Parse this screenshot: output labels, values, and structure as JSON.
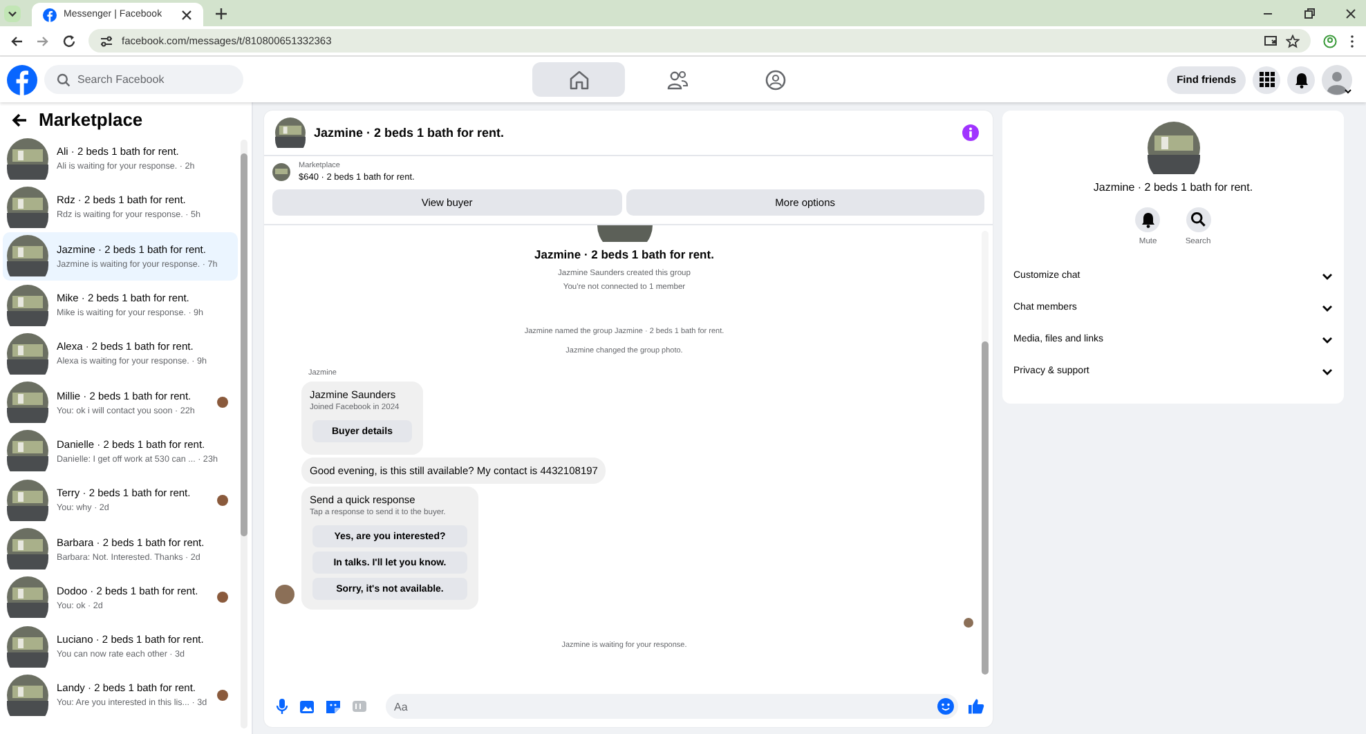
{
  "browser": {
    "tab_title": "Messenger | Facebook",
    "url": "facebook.com/messages/t/810800651332363"
  },
  "header": {
    "search": {
      "placeholder": "Search Facebook"
    },
    "nav": [
      {
        "kind": "home",
        "selected": true
      },
      {
        "kind": "friends",
        "selected": false
      },
      {
        "kind": "groups",
        "selected": false
      }
    ],
    "find_friends": "Find friends"
  },
  "sidebar": {
    "title": "Marketplace",
    "items": [
      {
        "title": "Ali · 2 beds 1 bath for rent.",
        "preview": "Ali is waiting for your response. · 2h",
        "selected": false,
        "seen": false
      },
      {
        "title": "Rdz · 2 beds 1 bath for rent.",
        "preview": "Rdz is waiting for your response. · 5h",
        "selected": false,
        "seen": false
      },
      {
        "title": "Jazmine · 2 beds 1 bath for rent.",
        "preview": "Jazmine is waiting for your response. · 7h",
        "selected": true,
        "seen": false
      },
      {
        "title": "Mike · 2 beds 1 bath for rent.",
        "preview": "Mike is waiting for your response. · 9h",
        "selected": false,
        "seen": false
      },
      {
        "title": "Alexa · 2 beds 1 bath for rent.",
        "preview": "Alexa is waiting for your response. · 9h",
        "selected": false,
        "seen": false
      },
      {
        "title": "Millie · 2 beds 1 bath for rent.",
        "preview": "You: ok i will contact you soon · 22h",
        "selected": false,
        "seen": true
      },
      {
        "title": "Danielle · 2 beds 1 bath for rent.",
        "preview": "Danielle: I get off work at 530 can ... · 23h",
        "selected": false,
        "seen": false
      },
      {
        "title": "Terry · 2 beds 1 bath for rent.",
        "preview": "You: why · 2d",
        "selected": false,
        "seen": true
      },
      {
        "title": "Barbara · 2 beds 1 bath for rent.",
        "preview": "Barbara: Not. Interested. Thanks · 2d",
        "selected": false,
        "seen": false
      },
      {
        "title": "Dodoo · 2 beds 1 bath for rent.",
        "preview": "You: ok · 2d",
        "selected": false,
        "seen": true
      },
      {
        "title": "Luciano · 2 beds 1 bath for rent.",
        "preview": "You can now rate each other · 3d",
        "selected": false,
        "seen": false
      },
      {
        "title": "Landy · 2 beds 1 bath for rent.",
        "preview": "You: Are you interested in this lis... · 3d",
        "selected": false,
        "seen": true
      }
    ]
  },
  "chat": {
    "title": "Jazmine · 2 beds 1 bath for rent.",
    "listing": {
      "label": "Marketplace",
      "item": "$640 · 2 beds 1 bath for rent."
    },
    "actions": [
      "View buyer",
      "More options"
    ],
    "intro": {
      "title": "Jazmine · 2 beds 1 bath for rent.",
      "lines": [
        "Jazmine Saunders created this group",
        "You're not connected to 1 member"
      ]
    },
    "events": [
      "Jazmine named the group Jazmine · 2 beds 1 bath for rent.",
      "Jazmine changed the group photo."
    ],
    "sender": "Jazmine",
    "messages": [
      {
        "kind": "profile",
        "name": "Jazmine Saunders",
        "subtitle": "Joined Facebook in 2024",
        "button": "Buyer details"
      },
      {
        "kind": "text",
        "text": "Good evening, is this still available? My contact is 4432108197"
      },
      {
        "kind": "quick",
        "title": "Send a quick response",
        "subtitle": "Tap a response to send it to the buyer.",
        "options": [
          "Yes, are you interested?",
          "In talks. I'll let you know.",
          "Sorry, it's not available."
        ]
      }
    ],
    "status": "Jazmine is waiting for your response.",
    "composer": {
      "placeholder": "Aa"
    }
  },
  "details": {
    "title": "Jazmine · 2 beds 1 bath for rent.",
    "actions": [
      {
        "kind": "mute",
        "label": "Mute"
      },
      {
        "kind": "search",
        "label": "Search"
      }
    ],
    "sections": [
      {
        "label": "Customize chat",
        "expanded": false
      },
      {
        "label": "Chat members",
        "expanded": false
      },
      {
        "label": "Media, files and links",
        "expanded": false
      },
      {
        "label": "Privacy & support",
        "expanded": false
      }
    ]
  }
}
